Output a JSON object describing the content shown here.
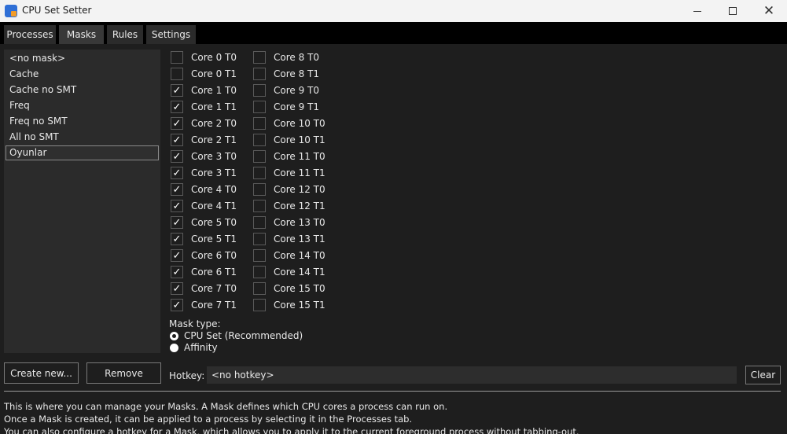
{
  "window": {
    "title": "CPU Set Setter",
    "minimize_icon": "minimize-icon",
    "maximize_icon": "maximize-icon",
    "close_icon": "close-icon",
    "close_glyph": "✕"
  },
  "tabs": [
    {
      "label": "Processes",
      "active": false
    },
    {
      "label": "Masks",
      "active": true
    },
    {
      "label": "Rules",
      "active": false
    },
    {
      "label": "Settings",
      "active": false
    }
  ],
  "masks": {
    "items": [
      "<no mask>",
      "Cache",
      "Cache no SMT",
      "Freq",
      "Freq no SMT",
      "All no SMT",
      "Oyunlar"
    ],
    "selected": "Oyunlar"
  },
  "cores": {
    "check_glyph": "✓",
    "left": [
      {
        "label": "Core 0 T0",
        "checked": false
      },
      {
        "label": "Core 0 T1",
        "checked": false
      },
      {
        "label": "Core 1 T0",
        "checked": true
      },
      {
        "label": "Core 1 T1",
        "checked": true
      },
      {
        "label": "Core 2 T0",
        "checked": true
      },
      {
        "label": "Core 2 T1",
        "checked": true
      },
      {
        "label": "Core 3 T0",
        "checked": true
      },
      {
        "label": "Core 3 T1",
        "checked": true
      },
      {
        "label": "Core 4 T0",
        "checked": true
      },
      {
        "label": "Core 4 T1",
        "checked": true
      },
      {
        "label": "Core 5 T0",
        "checked": true
      },
      {
        "label": "Core 5 T1",
        "checked": true
      },
      {
        "label": "Core 6 T0",
        "checked": true
      },
      {
        "label": "Core 6 T1",
        "checked": true
      },
      {
        "label": "Core 7 T0",
        "checked": true
      },
      {
        "label": "Core 7 T1",
        "checked": true
      }
    ],
    "right": [
      {
        "label": "Core 8 T0",
        "checked": false
      },
      {
        "label": "Core 8 T1",
        "checked": false
      },
      {
        "label": "Core 9 T0",
        "checked": false
      },
      {
        "label": "Core 9 T1",
        "checked": false
      },
      {
        "label": "Core 10 T0",
        "checked": false
      },
      {
        "label": "Core 10 T1",
        "checked": false
      },
      {
        "label": "Core 11 T0",
        "checked": false
      },
      {
        "label": "Core 11 T1",
        "checked": false
      },
      {
        "label": "Core 12 T0",
        "checked": false
      },
      {
        "label": "Core 12 T1",
        "checked": false
      },
      {
        "label": "Core 13 T0",
        "checked": false
      },
      {
        "label": "Core 13 T1",
        "checked": false
      },
      {
        "label": "Core 14 T0",
        "checked": false
      },
      {
        "label": "Core 14 T1",
        "checked": false
      },
      {
        "label": "Core 15 T0",
        "checked": false
      },
      {
        "label": "Core 15 T1",
        "checked": false
      }
    ]
  },
  "mask_type": {
    "label": "Mask type:",
    "options": [
      {
        "label": "CPU Set (Recommended)",
        "selected": true
      },
      {
        "label": "Affinity",
        "selected": false
      }
    ]
  },
  "buttons": {
    "create_new": "Create new...",
    "remove": "Remove",
    "clear": "Clear"
  },
  "hotkey": {
    "label": "Hotkey:",
    "value": "<no hotkey>"
  },
  "help_lines": [
    "This is where you can manage your Masks. A Mask defines which CPU cores a process can run on.",
    "Once a Mask is created, it can be applied to a process by selecting it in the Processes tab.",
    "You can also configure a hotkey for a Mask, which allows you to apply it to the current foreground process without tabbing-out."
  ],
  "colors": {
    "background": "#1e1e1e",
    "titlebar": "#f3f3f3",
    "list_background": "#2b2b2b",
    "text": "#e8e8e8"
  }
}
